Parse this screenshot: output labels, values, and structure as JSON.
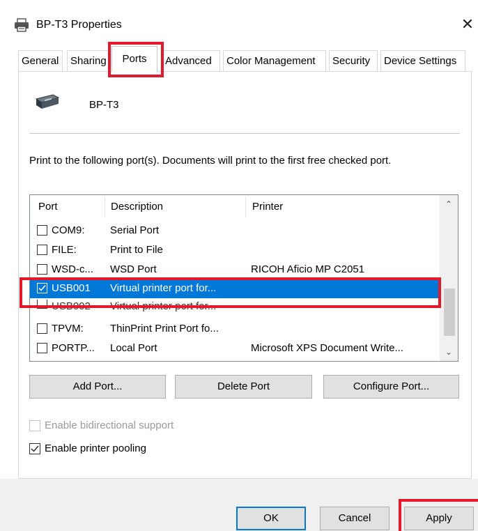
{
  "window": {
    "title": "BP-T3 Properties",
    "close_glyph": "✕"
  },
  "tabs": [
    {
      "label": "General"
    },
    {
      "label": "Sharing"
    },
    {
      "label": "Ports"
    },
    {
      "label": "Advanced"
    },
    {
      "label": "Color Management"
    },
    {
      "label": "Security"
    },
    {
      "label": "Device Settings"
    }
  ],
  "active_tab": "Ports",
  "printer": {
    "name": "BP-T3",
    "icon": "printer-icon"
  },
  "description": "Print to the following port(s). Documents will print to the first free checked port.",
  "port_list": {
    "headers": {
      "port": "Port",
      "description": "Description",
      "printer": "Printer"
    },
    "rows": [
      {
        "port": "COM9:",
        "description": "Serial Port",
        "printer": "",
        "checked": false,
        "selected": false
      },
      {
        "port": "FILE:",
        "description": "Print to File",
        "printer": "",
        "checked": false,
        "selected": false
      },
      {
        "port": "WSD-c...",
        "description": "WSD Port",
        "printer": "RICOH Aficio MP C2051",
        "checked": false,
        "selected": false
      },
      {
        "port": "USB001",
        "description": "Virtual printer port for...",
        "printer": "",
        "checked": true,
        "selected": true
      },
      {
        "port": "USB002",
        "description": "Virtual printer port for...",
        "printer": "",
        "checked": false,
        "selected": false
      },
      {
        "port": "TPVM:",
        "description": "ThinPrint Print Port fo...",
        "printer": "",
        "checked": false,
        "selected": false
      },
      {
        "port": "PORTP...",
        "description": "Local Port",
        "printer": "Microsoft XPS Document Write...",
        "checked": false,
        "selected": false
      }
    ]
  },
  "buttons": {
    "add_port": "Add Port...",
    "delete_port": "Delete Port",
    "configure_port": "Configure Port...",
    "ok": "OK",
    "cancel": "Cancel",
    "apply": "Apply"
  },
  "options": {
    "bidirectional": {
      "label": "Enable bidirectional support",
      "checked": false,
      "enabled": false
    },
    "pooling": {
      "label": "Enable printer pooling",
      "checked": true,
      "enabled": true
    }
  },
  "colors": {
    "selection": "#0078d7",
    "highlight": "#e3192b"
  }
}
